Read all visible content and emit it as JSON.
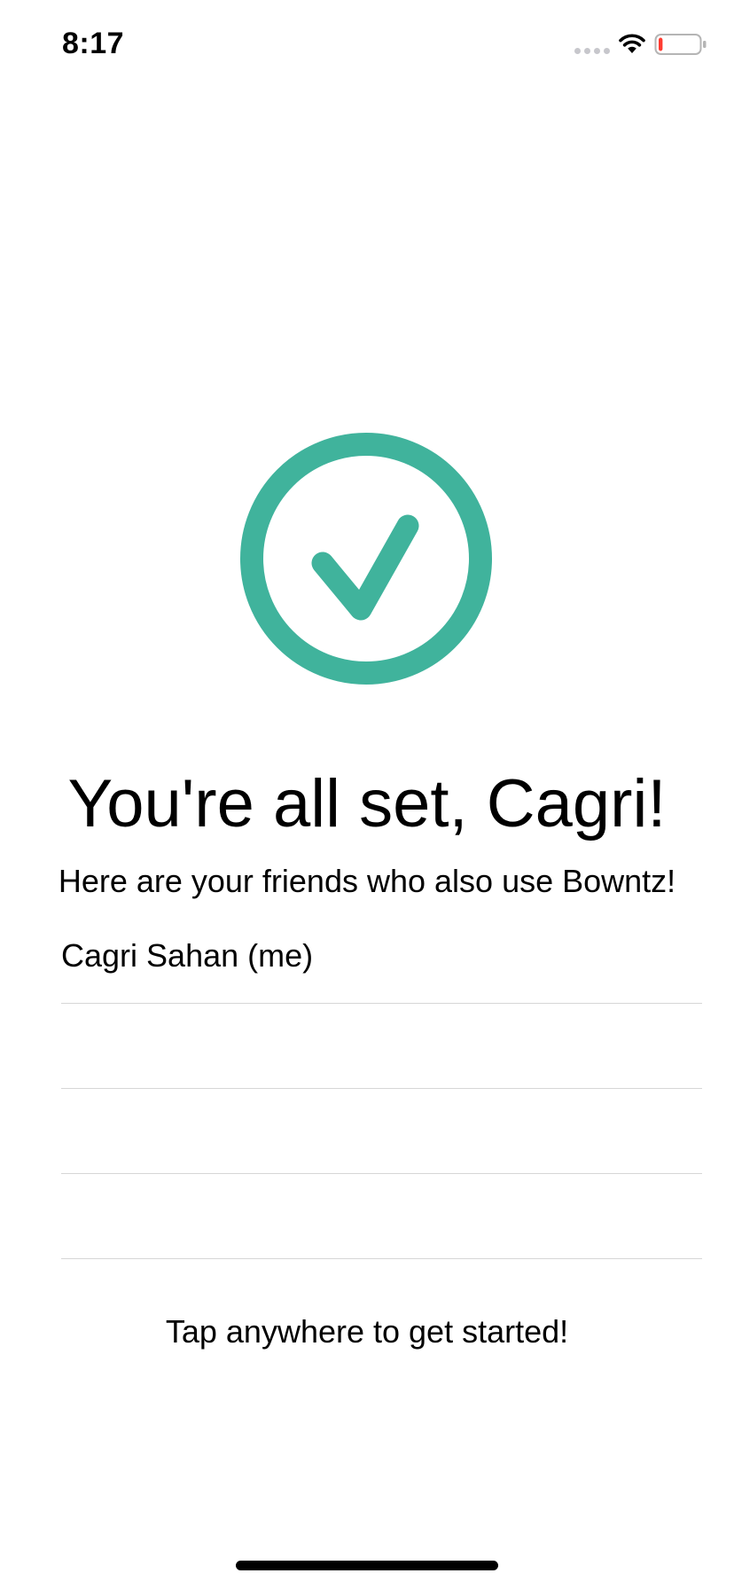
{
  "status_bar": {
    "time": "8:17",
    "signal_icon": "cellular-dots-icon",
    "wifi_icon": "wifi-icon",
    "battery_icon": "battery-low-icon",
    "battery_level": 0.1
  },
  "onboarding": {
    "success_icon": "checkmark-circle-icon",
    "title": "You're all set, Cagri!",
    "subtitle": "Here are your friends who also use Bowntz!",
    "friends": [
      {
        "name": "Cagri Sahan (me)"
      },
      {
        "name": ""
      },
      {
        "name": ""
      },
      {
        "name": ""
      }
    ],
    "cta": "Tap anywhere to get started!"
  },
  "colors": {
    "accent": "#40b39c",
    "battery_low": "#ff3b30",
    "separator": "#d6d6d6"
  }
}
